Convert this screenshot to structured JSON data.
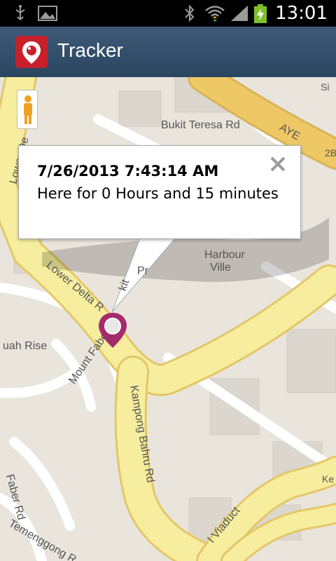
{
  "status_bar": {
    "time": "13:01",
    "icons": [
      "usb-icon",
      "image-icon",
      "bluetooth-icon",
      "wifi-icon",
      "signal-icon",
      "battery-charging-icon"
    ]
  },
  "app_bar": {
    "title": "Tracker",
    "logo_icon": "location-pin-icon",
    "bg_color": "#3a5672"
  },
  "map": {
    "labels": {
      "bukit_teresa": "Bukit Teresa Rd",
      "ayf": "AYE",
      "harbour_ville_1": "Harbour",
      "harbour_ville_2": "Ville",
      "lower_delta_top": "Lower De",
      "lower_delta_mid": "Lower Delta R",
      "mount_faber": "Mount Faber Rd",
      "kampong": "Kampong Bahru Rd",
      "uah_rise": "uah Rise",
      "faber_rd": "Faber Rd",
      "temenggong": "Temenggong R",
      "viaduct": "l Viaduct",
      "prince": "Pr",
      "kit": "kit",
      "si": "Si",
      "ke": "Ke",
      "twob": "2B"
    },
    "info_window": {
      "timestamp": "7/26/2013 7:43:14 AM",
      "message": "Here for 0 Hours and 15 minutes",
      "close_icon": "close-icon"
    },
    "marker_icon": "map-marker-icon",
    "pegman_icon": "street-view-pegman-icon",
    "colors": {
      "road": "#f5ee9a",
      "road_border": "#e6c96a",
      "land": "#e9e5dc",
      "block": "#d9d4cb",
      "marker": "#a42a6e"
    }
  }
}
